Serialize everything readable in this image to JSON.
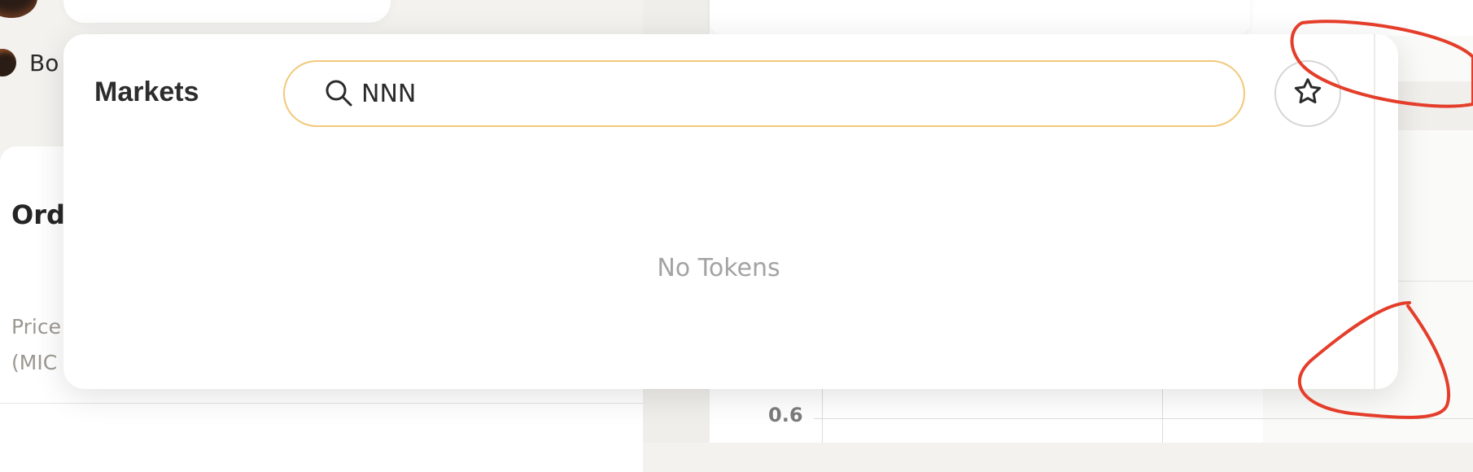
{
  "background": {
    "user_label": "Bo",
    "order_title": "Ord",
    "price_label_line1": "Price",
    "price_label_line2": "(MIC",
    "chart_tick": "0.6"
  },
  "markets": {
    "title": "Markets",
    "search": {
      "value": "NNN",
      "icon": "search-icon"
    },
    "favorite_icon": "star-outline-icon",
    "empty_message": "No Tokens"
  },
  "colors": {
    "search_border": "#f2c879",
    "annotation": "#e43d2a"
  }
}
